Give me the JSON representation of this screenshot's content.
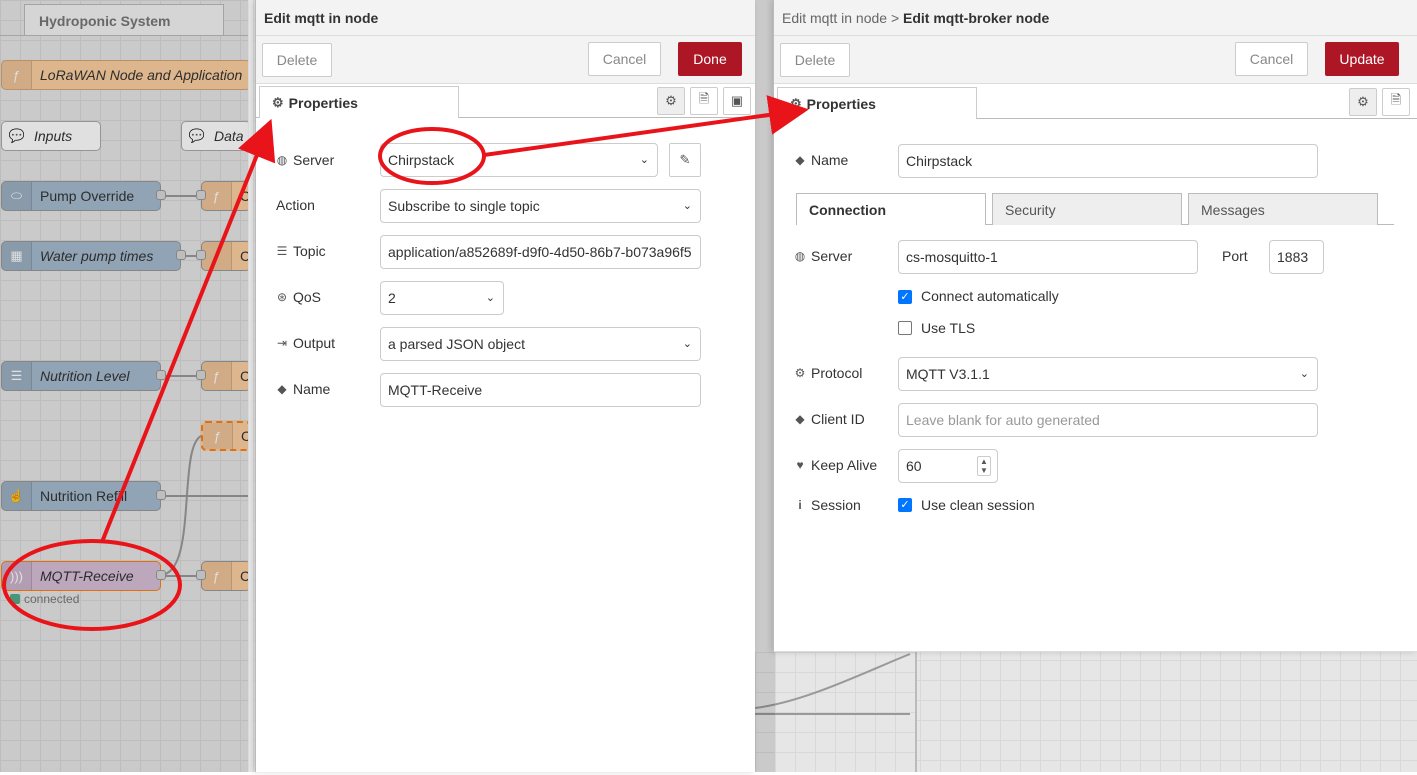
{
  "workspace": {
    "flow_tab": "Hydroponic System",
    "nodes": [
      {
        "label": "LoRaWAN Node and Application",
        "color": "#fdd0a2"
      },
      {
        "label": "Inputs",
        "color": "#ffffff"
      },
      {
        "label": "Data",
        "color": "#ffffff"
      },
      {
        "label": "Pump Override",
        "color": "#a6bbcf"
      },
      {
        "label": "Water pump times",
        "color": "#a6bbcf"
      },
      {
        "label": "Nutrition Level",
        "color": "#a6bbcf"
      },
      {
        "label": "Nutrition Refill",
        "color": "#a6bbcf"
      },
      {
        "label": "MQTT-Receive",
        "color": "#d8bfd8"
      }
    ],
    "mqtt_status": "connected",
    "partial_labels": {
      "c": "C",
      "f": "ƒ"
    }
  },
  "left_tray": {
    "title": "Edit mqtt in node",
    "delete_label": "Delete",
    "cancel_label": "Cancel",
    "done_label": "Done",
    "properties_tab": "Properties",
    "fields": {
      "server_label": "Server",
      "server_value": "Chirpstack",
      "action_label": "Action",
      "action_value": "Subscribe to single topic",
      "topic_label": "Topic",
      "topic_value": "application/a852689f-d9f0-4d50-86b7-b073a96f5",
      "qos_label": "QoS",
      "qos_value": "2",
      "output_label": "Output",
      "output_value": "a parsed JSON object",
      "name_label": "Name",
      "name_value": "MQTT-Receive"
    }
  },
  "right_tray": {
    "breadcrumb": "Edit mqtt in node",
    "separator": ">",
    "title": "Edit mqtt-broker node",
    "delete_label": "Delete",
    "cancel_label": "Cancel",
    "update_label": "Update",
    "properties_tab": "Properties",
    "name_label": "Name",
    "name_value": "Chirpstack",
    "tabs": [
      "Connection",
      "Security",
      "Messages"
    ],
    "connection": {
      "server_label": "Server",
      "server_value": "cs-mosquitto-1",
      "port_label": "Port",
      "port_value": "1883",
      "connect_auto_label": "Connect automatically",
      "connect_auto_checked": true,
      "use_tls_label": "Use TLS",
      "use_tls_checked": false,
      "protocol_label": "Protocol",
      "protocol_value": "MQTT V3.1.1",
      "client_id_label": "Client ID",
      "client_id_placeholder": "Leave blank for auto generated",
      "keep_alive_label": "Keep Alive",
      "keep_alive_value": "60",
      "session_label": "Session",
      "clean_session_label": "Use clean session",
      "clean_session_checked": true
    }
  },
  "annotation_color": "#e8141a"
}
